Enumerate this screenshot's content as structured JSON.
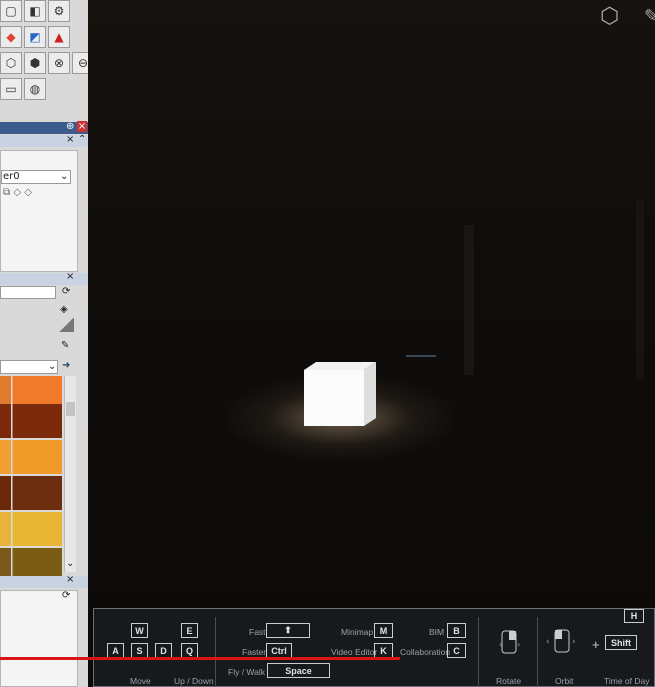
{
  "left_panel": {
    "layer_name": "er0",
    "default_value_text": ""
  },
  "viewport": {
    "top_right_icons": [
      "cube-outline-icon",
      "pen-icon"
    ]
  },
  "shortcuts_overlay": {
    "collapse_key": "H",
    "move_keys": [
      "W",
      "E",
      "A",
      "S",
      "D",
      "Q"
    ],
    "labels": {
      "move": "Move",
      "up_down": "Up / Down",
      "fast": "Fast",
      "faster": "Faster",
      "fly_walk": "Fly / Walk",
      "minimap": "Minimap",
      "video_editor": "Video Editor",
      "bim": "BIM",
      "collaboration": "Collaboration",
      "rotate": "Rotate",
      "orbit": "Orbit",
      "time_of_day": "Time of Day"
    },
    "keys": {
      "fast": "⬆",
      "faster": "Ctrl",
      "fly_walk": "Space",
      "minimap": "M",
      "video_editor": "K",
      "bim": "B",
      "collaboration": "C",
      "time_of_day": "Shift",
      "plus": "+"
    }
  },
  "video_progress": 0.61
}
